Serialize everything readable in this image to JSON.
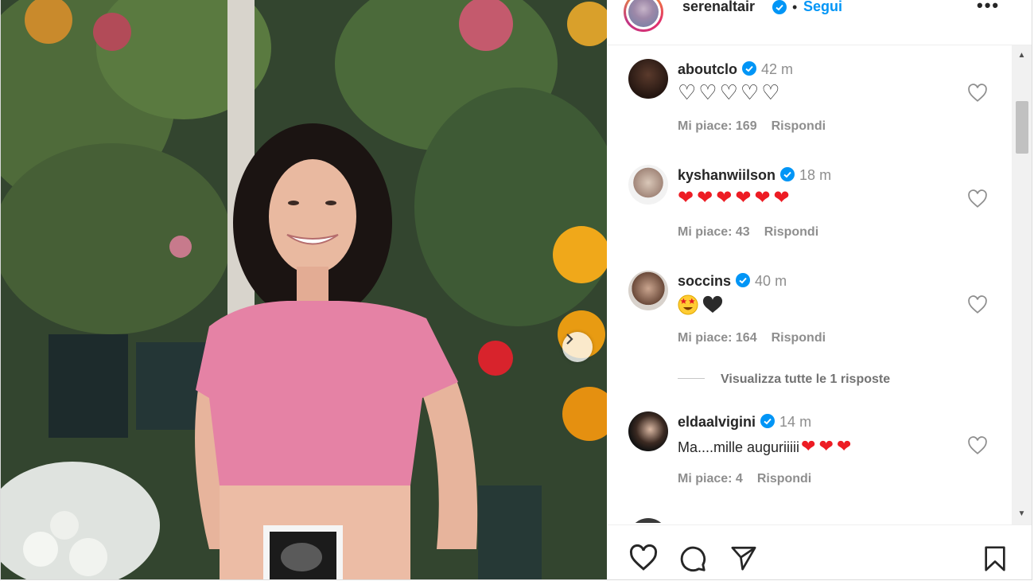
{
  "header": {
    "username": "serenaltair",
    "separator": "•",
    "follow_label": "Segui",
    "more_label": "•••",
    "avatar_icon": "user-avatar",
    "verified_icon": "verified-badge-icon"
  },
  "comments": [
    {
      "username": "aboutclo",
      "time": "42 m",
      "text": "♡♡♡♡♡",
      "likes": "Mi piace: 169",
      "reply": "Rispondi"
    },
    {
      "username": "kyshanwiilson",
      "time": "18 m",
      "text": "❤❤❤❤❤❤",
      "likes": "Mi piace: 43",
      "reply": "Rispondi"
    },
    {
      "username": "soccins",
      "time": "40 m",
      "text": "",
      "likes": "Mi piace: 164",
      "reply": "Rispondi"
    },
    {
      "username": "eldaalvigini",
      "time": "14 m",
      "text": "Ma....mille auguriiiii",
      "likes": "Mi piace: 4",
      "reply": "Rispondi"
    }
  ],
  "view_replies": "Visualizza tutte le 1 risposte",
  "colors": {
    "link": "#0095f6",
    "verified": "#0095f6",
    "heart_red": "#ed1c24",
    "meta_gray": "#8e8e8e"
  },
  "actions": {
    "like_icon": "heart-icon",
    "comment_icon": "comment-icon",
    "share_icon": "paper-plane-icon",
    "save_icon": "bookmark-icon"
  }
}
